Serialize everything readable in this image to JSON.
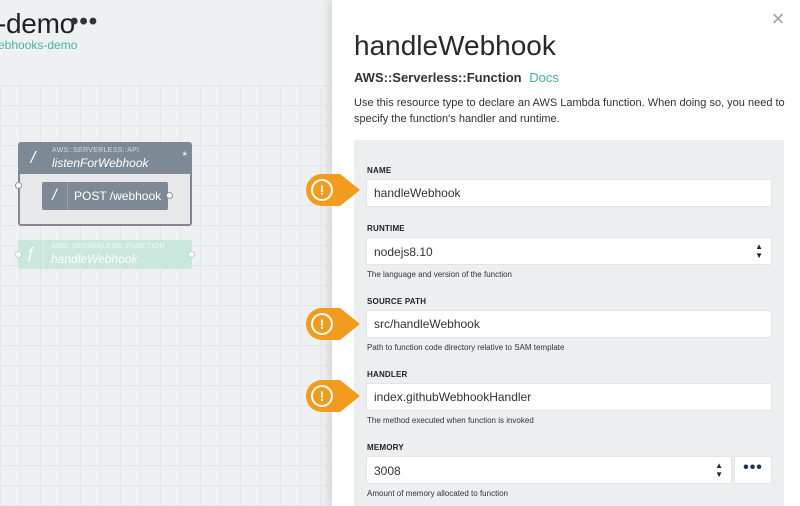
{
  "project": {
    "title": "-demo",
    "menu_icon": "•••",
    "subtitle": "ebhooks-demo"
  },
  "canvas": {
    "api_node": {
      "glyph": "/",
      "type_label": "AWS::SERVERLESS::API",
      "name": "listenForWebhook",
      "modified_marker": "*",
      "route": {
        "glyph": "/",
        "label": "POST /webhook"
      }
    },
    "function_node": {
      "glyph": "ƒ",
      "type_label": "AWS::SERVERLESS::FUNCTION",
      "name": "handleWebhook"
    }
  },
  "panel": {
    "close_icon": "×",
    "title": "handleWebhook",
    "resource_type": "AWS::Serverless::Function",
    "docs_label": "Docs",
    "description": "Use this resource type to declare an AWS Lambda function. When doing so, you need to specify the function's handler and runtime.",
    "fields": {
      "name": {
        "label": "NAME",
        "value": "handleWebhook"
      },
      "runtime": {
        "label": "RUNTIME",
        "value": "nodejs8.10",
        "help": "The language and version of the function"
      },
      "source_path": {
        "label": "SOURCE PATH",
        "value": "src/handleWebhook",
        "help": "Path to function code directory relative to SAM template"
      },
      "handler": {
        "label": "HANDLER",
        "value": "index.githubWebhookHandler",
        "help": "The method executed when function is invoked"
      },
      "memory": {
        "label": "MEMORY",
        "value": "3008",
        "help": "Amount of memory allocated to function",
        "more_label": "•••"
      }
    },
    "warning_glyph": "!"
  },
  "colors": {
    "accent_teal": "#3fb59f",
    "warning_orange": "#f29b1d",
    "node_gray": "#7d8a95",
    "function_green": "#c9e7dd"
  }
}
